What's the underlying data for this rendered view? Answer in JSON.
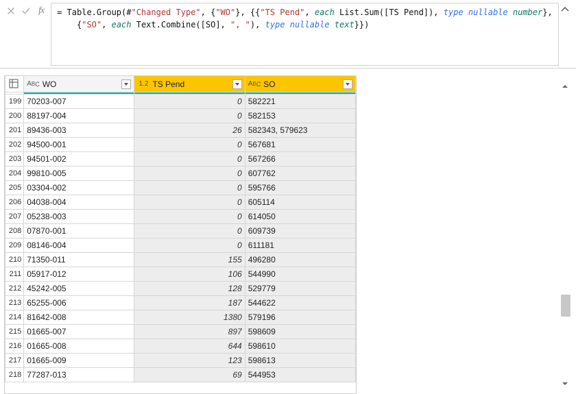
{
  "formula_bar": {
    "fx_label": "fx",
    "line1_tokens": [
      {
        "t": "= Table.Group(#",
        "c": "tok-op"
      },
      {
        "t": "\"Changed Type\"",
        "c": "tok-str"
      },
      {
        "t": ", {",
        "c": "tok-op"
      },
      {
        "t": "\"WO\"",
        "c": "tok-str"
      },
      {
        "t": "}, {{",
        "c": "tok-op"
      },
      {
        "t": "\"TS Pend\"",
        "c": "tok-str"
      },
      {
        "t": ", ",
        "c": "tok-op"
      },
      {
        "t": "each",
        "c": "tok-var"
      },
      {
        "t": " List.Sum([TS Pend]), ",
        "c": "tok-op"
      },
      {
        "t": "type nullable",
        "c": "tok-kw"
      },
      {
        "t": " ",
        "c": "tok-op"
      },
      {
        "t": "number",
        "c": "tok-var"
      },
      {
        "t": "},",
        "c": "tok-op"
      }
    ],
    "line2_tokens": [
      {
        "t": "    {",
        "c": "tok-op"
      },
      {
        "t": "\"SO\"",
        "c": "tok-str"
      },
      {
        "t": ", ",
        "c": "tok-op"
      },
      {
        "t": "each",
        "c": "tok-var"
      },
      {
        "t": " Text.Combine([SO], ",
        "c": "tok-op"
      },
      {
        "t": "\", \"",
        "c": "tok-str"
      },
      {
        "t": "), ",
        "c": "tok-op"
      },
      {
        "t": "type nullable",
        "c": "tok-kw"
      },
      {
        "t": " ",
        "c": "tok-op"
      },
      {
        "t": "text",
        "c": "tok-var"
      },
      {
        "t": "}})",
        "c": "tok-op"
      }
    ]
  },
  "columns": {
    "wo": {
      "type_label": "ABC",
      "name": "WO"
    },
    "ts": {
      "type_label": "1.2",
      "name": "TS Pend"
    },
    "so": {
      "type_label": "ABC",
      "name": "SO"
    }
  },
  "rows": [
    {
      "idx": 199,
      "wo": "70203-007",
      "ts": "0",
      "so": "582221"
    },
    {
      "idx": 200,
      "wo": "88197-004",
      "ts": "0",
      "so": "582153"
    },
    {
      "idx": 201,
      "wo": "89436-003",
      "ts": "26",
      "so": "582343, 579623"
    },
    {
      "idx": 202,
      "wo": "94500-001",
      "ts": "0",
      "so": "567681"
    },
    {
      "idx": 203,
      "wo": "94501-002",
      "ts": "0",
      "so": "567266"
    },
    {
      "idx": 204,
      "wo": "99810-005",
      "ts": "0",
      "so": "607762"
    },
    {
      "idx": 205,
      "wo": "03304-002",
      "ts": "0",
      "so": "595766"
    },
    {
      "idx": 206,
      "wo": "04038-004",
      "ts": "0",
      "so": "605114"
    },
    {
      "idx": 207,
      "wo": "05238-003",
      "ts": "0",
      "so": "614050"
    },
    {
      "idx": 208,
      "wo": "07870-001",
      "ts": "0",
      "so": "609739"
    },
    {
      "idx": 209,
      "wo": "08146-004",
      "ts": "0",
      "so": "611181"
    },
    {
      "idx": 210,
      "wo": "71350-011",
      "ts": "155",
      "so": "496280"
    },
    {
      "idx": 211,
      "wo": "05917-012",
      "ts": "106",
      "so": "544990"
    },
    {
      "idx": 212,
      "wo": "45242-005",
      "ts": "128",
      "so": "529779"
    },
    {
      "idx": 213,
      "wo": "65255-006",
      "ts": "187",
      "so": "544622"
    },
    {
      "idx": 214,
      "wo": "81642-008",
      "ts": "1380",
      "so": "579196"
    },
    {
      "idx": 215,
      "wo": "01665-007",
      "ts": "897",
      "so": "598609"
    },
    {
      "idx": 216,
      "wo": "01665-008",
      "ts": "644",
      "so": "598610"
    },
    {
      "idx": 217,
      "wo": "01665-009",
      "ts": "123",
      "so": "598613"
    },
    {
      "idx": 218,
      "wo": "77287-013",
      "ts": "69",
      "so": "544953"
    }
  ],
  "colors": {
    "accent": "#01B8AA",
    "highlight": "#FCC500"
  }
}
